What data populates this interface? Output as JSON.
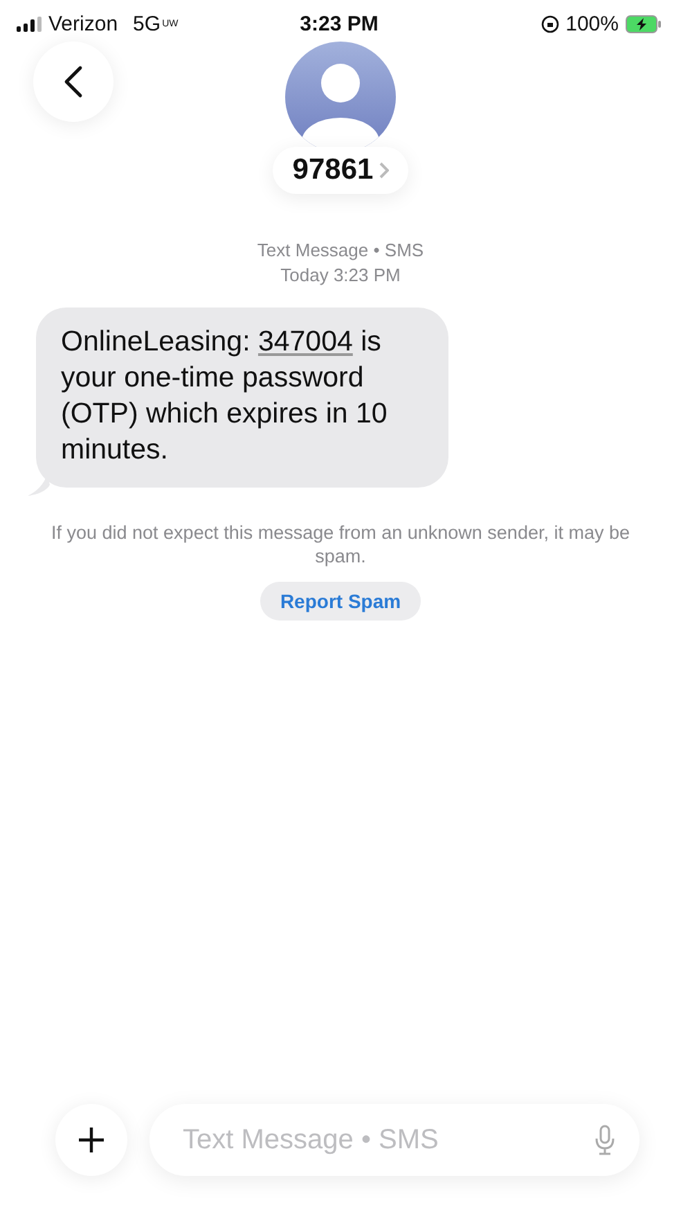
{
  "status_bar": {
    "carrier": "Verizon",
    "network": "5G",
    "network_tag": "UW",
    "time": "3:23 PM",
    "battery": "100%",
    "charging": true
  },
  "contact": {
    "name": "97861"
  },
  "thread_header": {
    "service": "Text Message • SMS",
    "timestamp": "Today 3:23 PM"
  },
  "messages": [
    {
      "kind": "incoming",
      "before": "OnlineLeasing: ",
      "code": "347004",
      "after": " is your one-time password (OTP) which expires in 10 minutes."
    }
  ],
  "spam_notice": {
    "text": "If you did not expect this message from an unknown sender, it may be spam.",
    "action": "Report Spam"
  },
  "compose": {
    "placeholder": "Text Message • SMS"
  }
}
